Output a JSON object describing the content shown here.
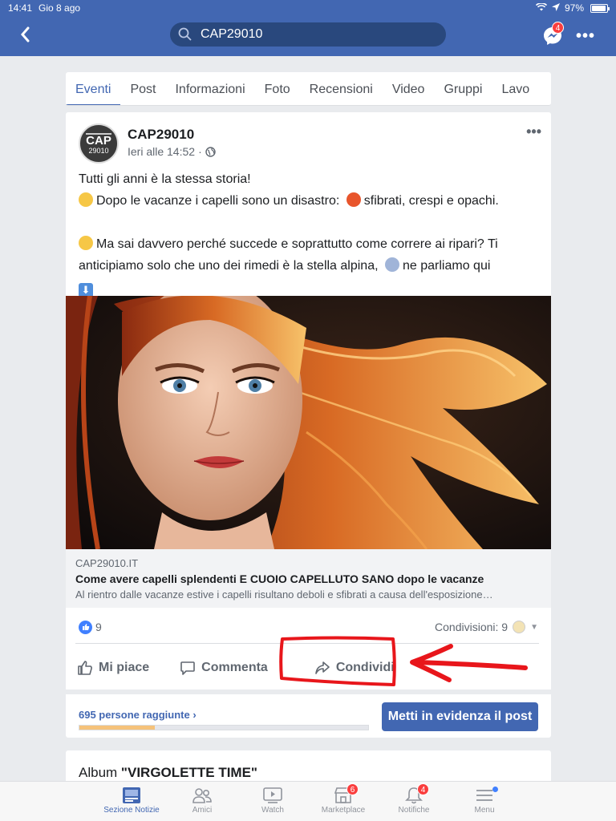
{
  "status": {
    "time": "14:41",
    "date": "Gio 8 ago",
    "battery": "97%"
  },
  "search": {
    "value": "CAP29010"
  },
  "messenger": {
    "badge": "4"
  },
  "tabs": [
    "Eventi",
    "Post",
    "Informazioni",
    "Foto",
    "Recensioni",
    "Video",
    "Gruppi",
    "Lavo"
  ],
  "post": {
    "page_name": "CAP29010",
    "avatar_text": "CAP",
    "avatar_sub": "29010",
    "time": "Ieri alle 14:52",
    "line1": "Tutti gli anni è la stessa storia!",
    "line2a": "Dopo le vacanze i capelli sono un disastro:",
    "line2b": "sfibrati, crespi e opachi.",
    "line3a": "Ma sai davvero perché succede e soprattutto come correre ai ripari? Ti anticipiamo solo che uno dei rimedi è la stella alpina,",
    "line3b": "ne parliamo qui",
    "link_domain": "CAP29010.IT",
    "link_title": "Come avere capelli splendenti E CUOIO CAPELLUTO SANO dopo le vacanze",
    "link_desc": "Al rientro dalle vacanze estive i capelli risultano deboli e sfibrati a causa dell'esposizione…",
    "likes": "9",
    "shares": "Condivisioni: 9",
    "like_label": "Mi piace",
    "comment_label": "Commenta",
    "share_label": "Condividi",
    "reach": "695 persone raggiunte",
    "reach_fraction": 0.26,
    "boost_label": "Metti in evidenza il post"
  },
  "album": {
    "prefix": "Album ",
    "title": "\"VIRGOLETTE TIME\""
  },
  "tabbar": [
    {
      "label": "Sezione Notizie",
      "icon": "news-feed-icon"
    },
    {
      "label": "Amici",
      "icon": "friends-icon"
    },
    {
      "label": "Watch",
      "icon": "watch-icon"
    },
    {
      "label": "Marketplace",
      "icon": "marketplace-icon",
      "badge": "6"
    },
    {
      "label": "Notifiche",
      "icon": "bell-icon",
      "badge": "4"
    },
    {
      "label": "Menu",
      "icon": "menu-icon"
    }
  ],
  "colors": {
    "brand": "#4267b2",
    "annotation": "#e8161b"
  }
}
